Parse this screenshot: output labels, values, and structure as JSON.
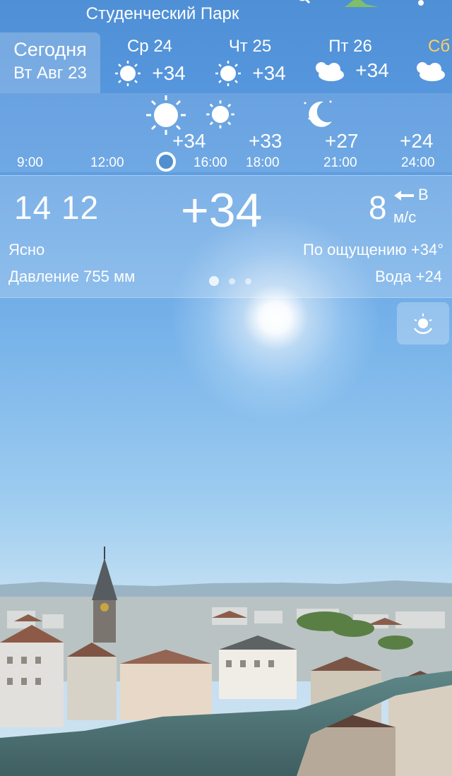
{
  "location": "Студенческий Парк",
  "days": {
    "today": {
      "label": "Сегодня",
      "date": "Вт Авг 23"
    },
    "list": [
      {
        "name": "Ср 24",
        "temp": "+34",
        "icon": "sun-icon"
      },
      {
        "name": "Чт 25",
        "temp": "+34",
        "icon": "sun-icon"
      },
      {
        "name": "Пт 26",
        "temp": "+34",
        "icon": "partly-cloudy-icon"
      },
      {
        "name": "Сб",
        "temp": "",
        "icon": "partly-cloudy-icon"
      }
    ]
  },
  "hours": {
    "labels": [
      "9:00",
      "12:00",
      "16:00",
      "18:00",
      "21:00",
      "24:00"
    ],
    "temps": [
      "+34",
      "+33",
      "+27",
      "+24"
    ]
  },
  "current": {
    "sunrise": "14 12",
    "temp": "+34",
    "wind_speed": "8",
    "wind_dir": "В",
    "wind_unit": "м/с",
    "condition": "Ясно",
    "feels_like": "По ощущению +34°",
    "pressure": "Давление 755 мм",
    "water": "Вода +24"
  },
  "colors": {
    "sky_top": "#4f8fd6",
    "sky_bottom": "#cfe3f0"
  }
}
